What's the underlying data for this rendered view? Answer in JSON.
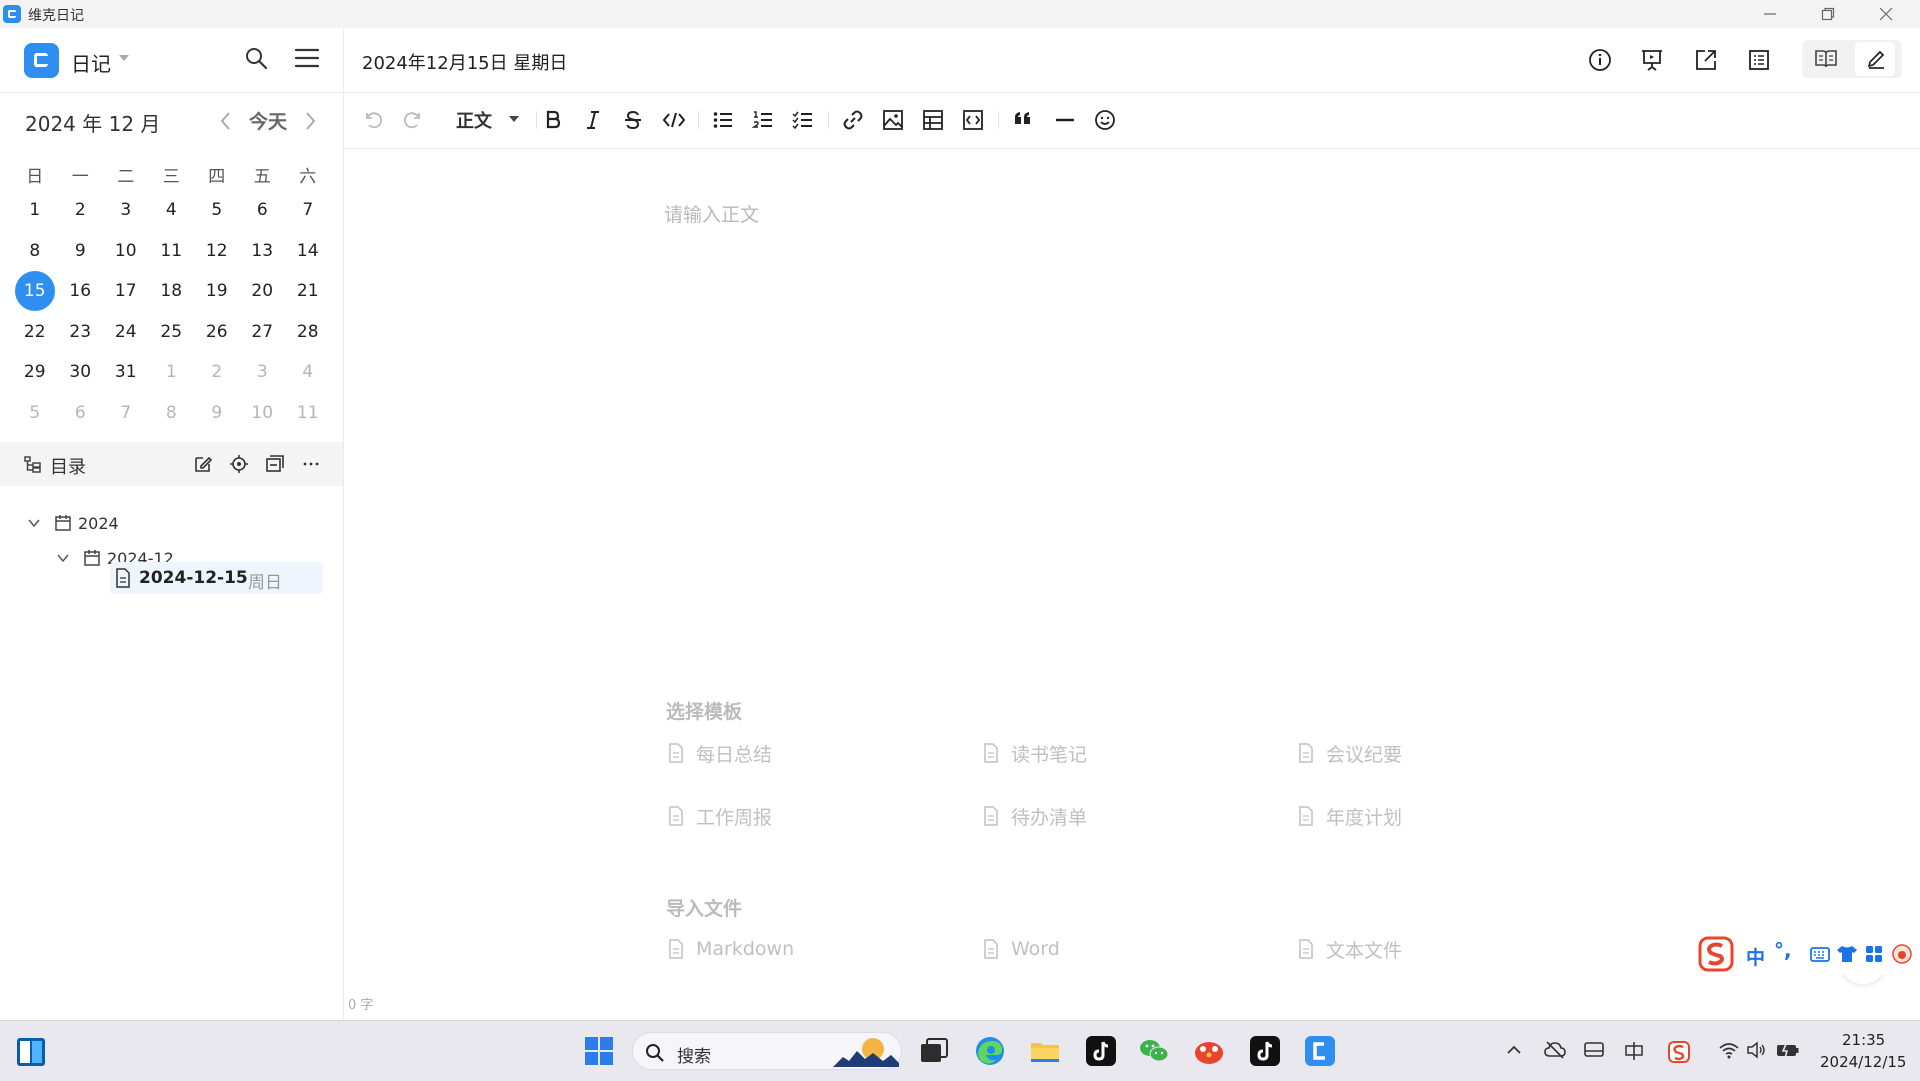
{
  "app": {
    "title": "维克日记"
  },
  "colors": {
    "accent": "#2f8ff0",
    "selected_row": "#eef5fd",
    "muted_text": "#c0c0c0"
  },
  "sidebar": {
    "notebook": "日记",
    "month_label": "2024 年 12 月",
    "today_label": "今天",
    "weekdays": [
      "日",
      "一",
      "二",
      "三",
      "四",
      "五",
      "六"
    ],
    "weeks": [
      [
        [
          "1",
          false
        ],
        [
          "2",
          false
        ],
        [
          "3",
          false
        ],
        [
          "4",
          false
        ],
        [
          "5",
          false
        ],
        [
          "6",
          false
        ],
        [
          "7",
          false
        ]
      ],
      [
        [
          "8",
          false
        ],
        [
          "9",
          false
        ],
        [
          "10",
          false
        ],
        [
          "11",
          false
        ],
        [
          "12",
          false
        ],
        [
          "13",
          false
        ],
        [
          "14",
          false
        ]
      ],
      [
        [
          "15",
          false
        ],
        [
          "16",
          false
        ],
        [
          "17",
          false
        ],
        [
          "18",
          false
        ],
        [
          "19",
          false
        ],
        [
          "20",
          false
        ],
        [
          "21",
          false
        ]
      ],
      [
        [
          "22",
          false
        ],
        [
          "23",
          false
        ],
        [
          "24",
          false
        ],
        [
          "25",
          false
        ],
        [
          "26",
          false
        ],
        [
          "27",
          false
        ],
        [
          "28",
          false
        ]
      ],
      [
        [
          "29",
          false
        ],
        [
          "30",
          false
        ],
        [
          "31",
          false
        ],
        [
          "1",
          true
        ],
        [
          "2",
          true
        ],
        [
          "3",
          true
        ],
        [
          "4",
          true
        ]
      ],
      [
        [
          "5",
          true
        ],
        [
          "6",
          true
        ],
        [
          "7",
          true
        ],
        [
          "8",
          true
        ],
        [
          "9",
          true
        ],
        [
          "10",
          true
        ],
        [
          "11",
          true
        ]
      ]
    ],
    "selected_day": "15",
    "toc": {
      "title": "目录",
      "tree": {
        "year": "2024",
        "month": "2024-12",
        "note_title": "2024-12-15",
        "note_weekday": "周日"
      }
    }
  },
  "editor": {
    "date_title": "2024年12月15日 星期日",
    "paragraph_style": "正文",
    "placeholder": "请输入正文",
    "word_count": "0 字",
    "help_label": "?",
    "templates_title": "选择模板",
    "templates": [
      "每日总结",
      "读书笔记",
      "会议纪要",
      "工作周报",
      "待办清单",
      "年度计划"
    ],
    "import_title": "导入文件",
    "imports": [
      "Markdown",
      "Word",
      "文本文件"
    ]
  },
  "ime": {
    "mode": "中",
    "punct": "°,"
  },
  "taskbar": {
    "search_placeholder": "搜索",
    "time": "21:35",
    "date": "2024/12/15"
  }
}
